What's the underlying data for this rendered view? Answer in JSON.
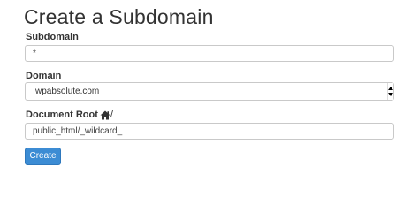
{
  "page": {
    "title": "Create a Subdomain"
  },
  "form": {
    "subdomain": {
      "label": "Subdomain",
      "value": "*"
    },
    "domain": {
      "label": "Domain",
      "selected": "wpabsolute.com"
    },
    "document_root": {
      "label": "Document Root",
      "icon": "home-icon",
      "suffix": "/",
      "value": "public_html/_wildcard_"
    },
    "submit_label": "Create"
  },
  "colors": {
    "primary_button": "#3c8cd4",
    "text": "#333333",
    "border": "#c9c9c9"
  }
}
